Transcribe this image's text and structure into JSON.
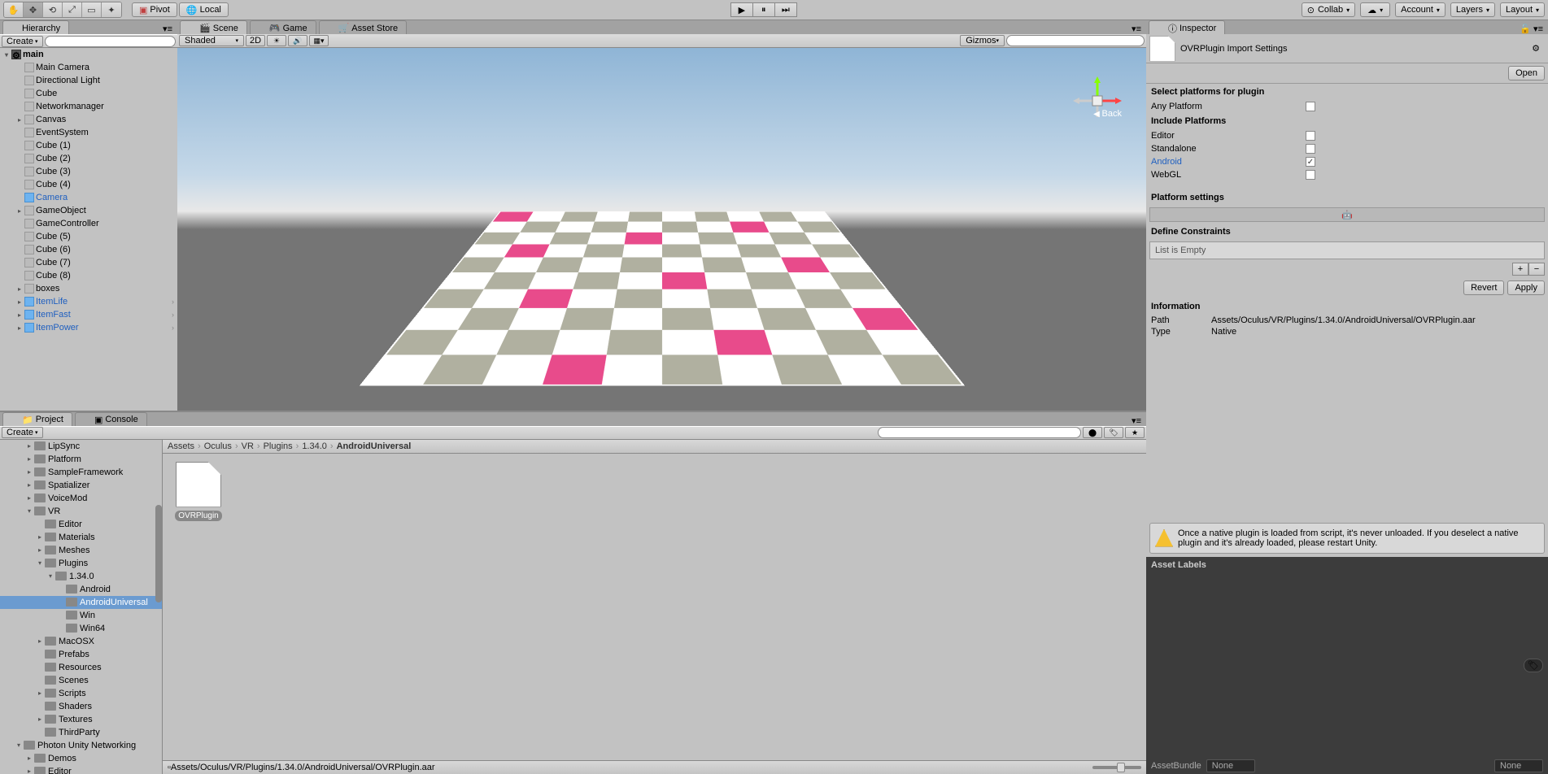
{
  "toolbar": {
    "pivot": "Pivot",
    "local": "Local",
    "collab": "Collab",
    "account": "Account",
    "layers": "Layers",
    "layout": "Layout"
  },
  "hierarchy": {
    "tab": "Hierarchy",
    "create": "Create",
    "scene": "main",
    "items": [
      {
        "label": "Main Camera",
        "indent": 1
      },
      {
        "label": "Directional Light",
        "indent": 1
      },
      {
        "label": "Cube",
        "indent": 1
      },
      {
        "label": "Networkmanager",
        "indent": 1
      },
      {
        "label": "Canvas",
        "indent": 1,
        "children": true
      },
      {
        "label": "EventSystem",
        "indent": 1
      },
      {
        "label": "Cube (1)",
        "indent": 1
      },
      {
        "label": "Cube (2)",
        "indent": 1
      },
      {
        "label": "Cube (3)",
        "indent": 1
      },
      {
        "label": "Cube (4)",
        "indent": 1
      },
      {
        "label": "Camera",
        "indent": 1,
        "prefab": true
      },
      {
        "label": "GameObject",
        "indent": 1,
        "children": true
      },
      {
        "label": "GameController",
        "indent": 1
      },
      {
        "label": "Cube (5)",
        "indent": 1
      },
      {
        "label": "Cube (6)",
        "indent": 1
      },
      {
        "label": "Cube (7)",
        "indent": 1
      },
      {
        "label": "Cube (8)",
        "indent": 1
      },
      {
        "label": "boxes",
        "indent": 1,
        "children": true
      },
      {
        "label": "ItemLife",
        "indent": 1,
        "prefab": true,
        "children": true,
        "chev": true
      },
      {
        "label": "ItemFast",
        "indent": 1,
        "prefab": true,
        "children": true,
        "chev": true
      },
      {
        "label": "ItemPower",
        "indent": 1,
        "prefab": true,
        "children": true,
        "chev": true
      }
    ]
  },
  "sceneTabs": {
    "scene": "Scene",
    "game": "Game",
    "asset": "Asset Store"
  },
  "sceneToolbar": {
    "shaded": "Shaded",
    "twod": "2D",
    "gizmos": "Gizmos",
    "back": "Back"
  },
  "project": {
    "tabProject": "Project",
    "tabConsole": "Console",
    "create": "Create",
    "folders": [
      {
        "label": "LipSync",
        "indent": 2,
        "children": true
      },
      {
        "label": "Platform",
        "indent": 2,
        "children": true
      },
      {
        "label": "SampleFramework",
        "indent": 2,
        "children": true
      },
      {
        "label": "Spatializer",
        "indent": 2,
        "children": true
      },
      {
        "label": "VoiceMod",
        "indent": 2,
        "children": true
      },
      {
        "label": "VR",
        "indent": 2,
        "children": true,
        "open": true
      },
      {
        "label": "Editor",
        "indent": 3
      },
      {
        "label": "Materials",
        "indent": 3,
        "children": true
      },
      {
        "label": "Meshes",
        "indent": 3,
        "children": true
      },
      {
        "label": "Plugins",
        "indent": 3,
        "children": true,
        "open": true
      },
      {
        "label": "1.34.0",
        "indent": 4,
        "children": true,
        "open": true
      },
      {
        "label": "Android",
        "indent": 5
      },
      {
        "label": "AndroidUniversal",
        "indent": 5,
        "selected": true
      },
      {
        "label": "Win",
        "indent": 5
      },
      {
        "label": "Win64",
        "indent": 5
      },
      {
        "label": "MacOSX",
        "indent": 3,
        "children": true
      },
      {
        "label": "Prefabs",
        "indent": 3
      },
      {
        "label": "Resources",
        "indent": 3
      },
      {
        "label": "Scenes",
        "indent": 3
      },
      {
        "label": "Scripts",
        "indent": 3,
        "children": true
      },
      {
        "label": "Shaders",
        "indent": 3
      },
      {
        "label": "Textures",
        "indent": 3,
        "children": true
      },
      {
        "label": "ThirdParty",
        "indent": 3
      },
      {
        "label": "Photon Unity Networking",
        "indent": 1,
        "children": true,
        "open": true
      },
      {
        "label": "Demos",
        "indent": 2,
        "children": true
      },
      {
        "label": "Editor",
        "indent": 2,
        "children": true
      }
    ],
    "breadcrumb": [
      "Assets",
      "Oculus",
      "VR",
      "Plugins",
      "1.34.0",
      "AndroidUniversal"
    ],
    "assetItem": "OVRPlugin",
    "footerPath": "Assets/Oculus/VR/Plugins/1.34.0/AndroidUniversal/OVRPlugin.aar"
  },
  "inspector": {
    "tab": "Inspector",
    "title": "OVRPlugin Import Settings",
    "open": "Open",
    "selectPlatforms": "Select platforms for plugin",
    "anyPlatform": "Any Platform",
    "includePlatforms": "Include Platforms",
    "platforms": [
      {
        "name": "Editor",
        "checked": false
      },
      {
        "name": "Standalone",
        "checked": false
      },
      {
        "name": "Android",
        "checked": true,
        "blue": true
      },
      {
        "name": "WebGL",
        "checked": false
      }
    ],
    "platformSettings": "Platform settings",
    "defineConstraints": "Define Constraints",
    "listEmpty": "List is Empty",
    "revert": "Revert",
    "apply": "Apply",
    "information": "Information",
    "pathLabel": "Path",
    "pathValue": "Assets/Oculus/VR/Plugins/1.34.0/AndroidUniversal/OVRPlugin.aar",
    "typeLabel": "Type",
    "typeValue": "Native",
    "warning": "Once a native plugin is loaded from script, it's never unloaded. If you deselect a native plugin and it's already loaded, please restart Unity.",
    "assetLabels": "Asset Labels",
    "assetBundle": "AssetBundle",
    "none": "None"
  }
}
